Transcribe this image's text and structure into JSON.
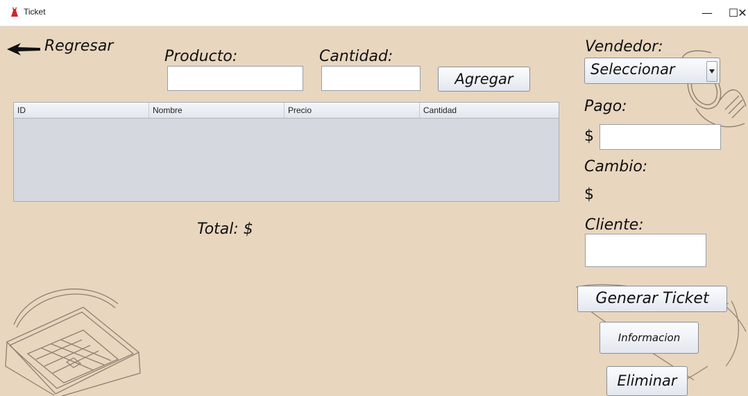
{
  "window": {
    "title": "Ticket",
    "controls": {
      "minimize": "—",
      "maximize": "☐",
      "close": "✕"
    }
  },
  "nav": {
    "back_label": "Regresar"
  },
  "form": {
    "producto_label": "Producto:",
    "producto_value": "",
    "cantidad_label": "Cantidad:",
    "cantidad_value": "",
    "agregar_label": "Agregar"
  },
  "table": {
    "columns": [
      "ID",
      "Nombre",
      "Precio",
      "Cantidad"
    ],
    "rows": []
  },
  "total": {
    "label": "Total: $",
    "value": ""
  },
  "side": {
    "vendedor_label": "Vendedor:",
    "vendedor_selected": "Seleccionar",
    "pago_label": "Pago:",
    "pago_currency": "$",
    "pago_value": "",
    "cambio_label": "Cambio:",
    "cambio_currency": "$",
    "cambio_value": "",
    "cliente_label": "Cliente:",
    "cliente_value": "",
    "generar_label": "Generar Ticket",
    "informacion_label": "Informacion",
    "eliminar_label": "Eliminar"
  },
  "colors": {
    "background": "#e8d6bf",
    "table_body": "#d5d8df",
    "app_icon": "#d4232a"
  }
}
